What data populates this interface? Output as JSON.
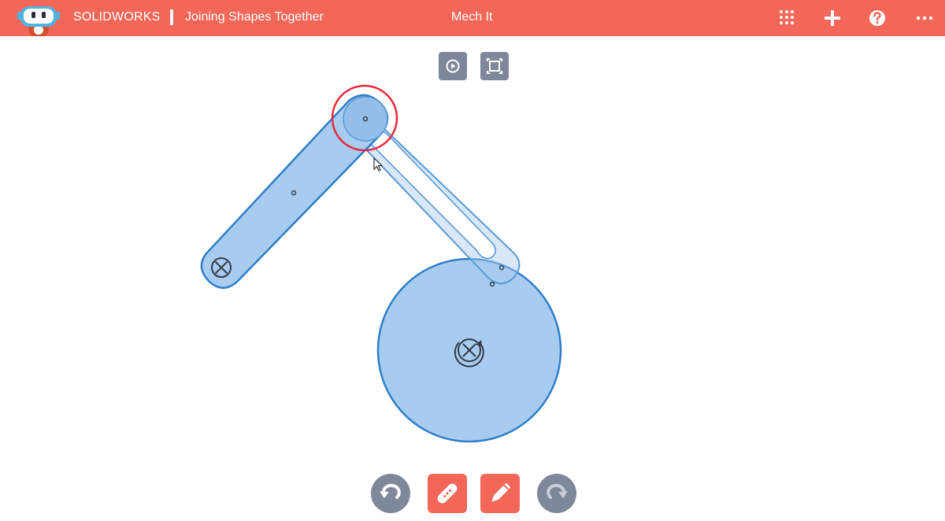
{
  "header": {
    "brand": "SOLIDWORKS",
    "document_title": "Joining Shapes Together",
    "app_name": "Mech It",
    "icons": [
      "apps-grid-icon",
      "plus-icon",
      "help-icon",
      "more-icon"
    ],
    "background_color": "#f26758"
  },
  "canvas_toolbar": {
    "icons": [
      "play-icon",
      "fit-to-screen-icon"
    ],
    "button_color": "#7f879b"
  },
  "bottom_toolbar": {
    "icons": [
      "undo-icon",
      "bandage-link-icon",
      "pencil-icon",
      "redo-icon"
    ],
    "round_color": "#7f879b",
    "square_color": "#f26758"
  },
  "colors": {
    "shape_fill": "#a8ccf0",
    "shape_stroke": "#2f7ec8",
    "highlight_ring": "#e8283a"
  },
  "shapes": [
    {
      "kind": "link",
      "state": "solid",
      "anchor": "fixed-pivot"
    },
    {
      "kind": "link",
      "state": "ghost"
    },
    {
      "kind": "wheel",
      "anchor": "motor-pivot"
    }
  ]
}
